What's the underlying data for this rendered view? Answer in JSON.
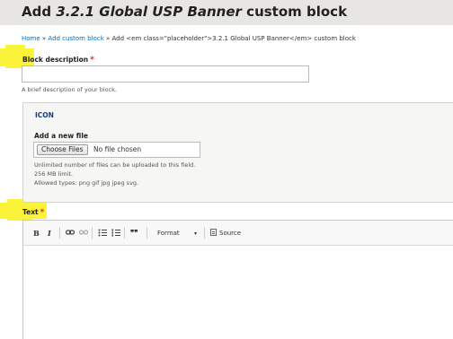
{
  "header": {
    "title_prefix": "Add",
    "title_em": "3.2.1 Global USP Banner",
    "title_suffix": "custom block"
  },
  "breadcrumb": {
    "home": "Home",
    "sep1": " » ",
    "custom_block": "Add custom block",
    "sep2": " » ",
    "current": "Add <em class=\"placeholder\">3.2.1 Global USP Banner</em> custom block"
  },
  "block_description": {
    "label": "Block description",
    "required_marker": "*",
    "value": "",
    "help": "A brief description of your block."
  },
  "icon_field": {
    "legend": "ICON",
    "new_file_label": "Add a new file",
    "choose_button": "Choose Files",
    "no_file_text": "No file chosen",
    "help_lines": [
      "Unlimited number of files can be uploaded to this field.",
      "256 MB limit.",
      "Allowed types: png gif jpg jpeg svg."
    ]
  },
  "text_field": {
    "label": "Text",
    "required_marker": "*",
    "toolbar": {
      "bold": "B",
      "italic": "I",
      "link_icon": "link-icon",
      "unlink_icon": "unlink-icon",
      "bullet_list_icon": "bulleted-list-icon",
      "numbered_list_icon": "numbered-list-icon",
      "blockquote": "❞❞",
      "format_label": "Format",
      "format_arrow": "▾",
      "source_label": "Source"
    }
  }
}
